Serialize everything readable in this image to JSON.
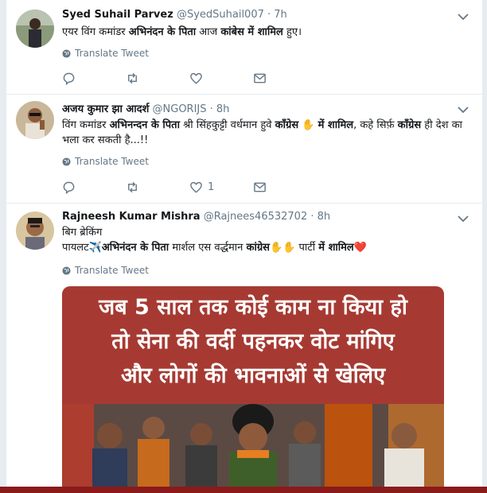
{
  "tweets": [
    {
      "name": "Syed Suhail Parvez",
      "handle": "@SyedSuhail007",
      "sep": " · ",
      "time": "7h",
      "text_parts": [
        "एयर विंग कमांडर ",
        "अभिनंदन के पिता",
        " आज ",
        "कांबेस में शामिल",
        " हुए।"
      ],
      "translate": "Translate Tweet",
      "like_count": ""
    },
    {
      "name": "अजय कुमार झा आदर्श",
      "handle": "@NGORIJS",
      "sep": " · ",
      "time": "8h",
      "text_parts": [
        "विंग कमांडर ",
        "अभिनन्दन के पिता",
        " श्री सिंहकुट्टी वर्धमान हुवे ",
        "कॉंग्रेस",
        " ✋ ",
        "में शामिल",
        ", कहे सिर्फ़ ",
        "कॉंग्रेस",
        " ही देश का भला कर सकती है...!!"
      ],
      "translate": "Translate Tweet",
      "like_count": "1"
    },
    {
      "name": "Rajneesh Kumar Mishra",
      "handle": "@Rajnees46532702",
      "sep": " · ",
      "time": "8h",
      "text_line1": "बिग ब्रेकिंग",
      "text_parts": [
        "पायलट✈️",
        "अभिनंदन के पिता",
        " मार्शल एस वर्द्धमान ",
        "कांग्रेस",
        "✋✋ पार्टी ",
        "में शामिल",
        "❤️"
      ],
      "translate": "Translate Tweet",
      "media_lines": [
        "जब 5 साल तक कोई काम ना किया हो",
        "तो सेना की वर्दी पहनकर वोट मांगिए",
        "और लोगों की भावनाओं से खेलिए"
      ]
    }
  ],
  "colors": {
    "muted": "#657786",
    "media_banner": "#a63a32",
    "like_heart": "#e0245e"
  },
  "icons": [
    "chevron-down-icon",
    "globe-icon",
    "reply-icon",
    "retweet-icon",
    "like-icon",
    "message-icon"
  ]
}
